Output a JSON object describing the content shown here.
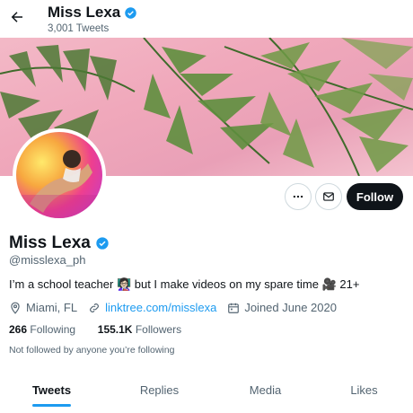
{
  "header": {
    "name": "Miss Lexa",
    "tweets_count": "3,001 Tweets"
  },
  "profile": {
    "display_name": "Miss Lexa",
    "handle": "@misslexa_ph",
    "bio": "I’m a school teacher 👩🏻‍🏫 but I make videos on my spare time 🎥 21+",
    "location": "Miami, FL",
    "link": "linktree.com/misslexa",
    "joined": "Joined June 2020",
    "following_count": "266",
    "following_label": "Following",
    "followers_count": "155.1K",
    "followers_label": "Followers",
    "not_followed": "Not followed by anyone you’re following"
  },
  "actions": {
    "follow_label": "Follow"
  },
  "tabs": [
    {
      "label": "Tweets"
    },
    {
      "label": "Replies"
    },
    {
      "label": "Media"
    },
    {
      "label": "Likes"
    }
  ],
  "colors": {
    "accent": "#1d9bf0",
    "text": "#0f1419",
    "muted": "#536471",
    "banner": "#f0a8bb"
  },
  "icons": [
    "back-arrow-icon",
    "verified-badge-icon",
    "more-icon",
    "message-icon",
    "location-icon",
    "link-icon",
    "calendar-icon"
  ]
}
